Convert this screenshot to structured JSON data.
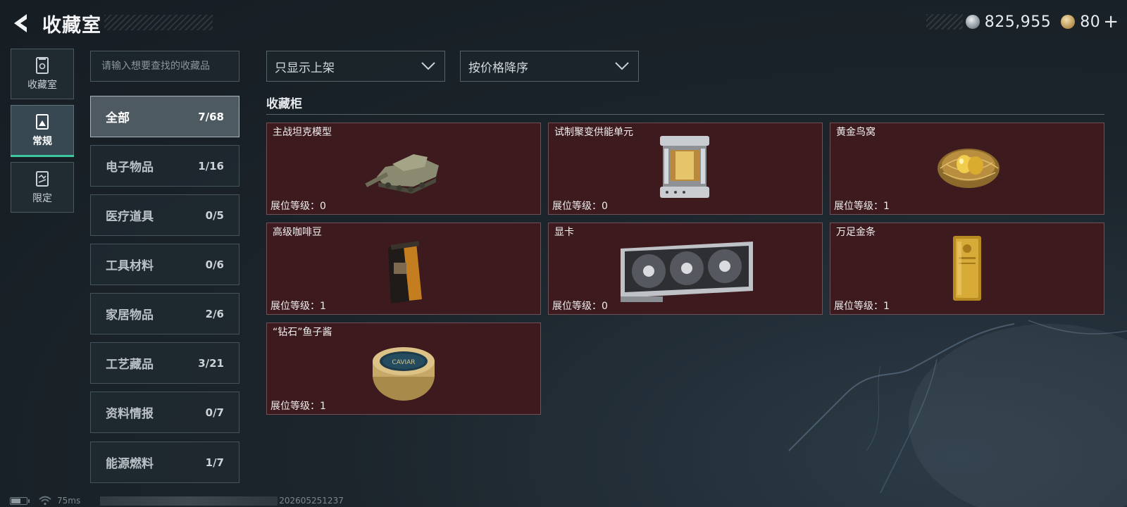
{
  "header": {
    "title": "收藏室",
    "currency": [
      {
        "icon": "silver-coin-icon",
        "value": "825,955"
      },
      {
        "icon": "gold-coin-icon",
        "value": "80"
      }
    ],
    "plus_label": "+"
  },
  "nav": [
    {
      "label": "收藏室",
      "icon": "collection-room-icon",
      "active": false
    },
    {
      "label": "常规",
      "icon": "regular-icon",
      "active": true
    },
    {
      "label": "限定",
      "icon": "limited-icon",
      "active": false
    }
  ],
  "search": {
    "placeholder": "请输入想要查找的收藏品",
    "value": ""
  },
  "categories": [
    {
      "name": "全部",
      "count": "7/68",
      "active": true
    },
    {
      "name": "电子物品",
      "count": "1/16"
    },
    {
      "name": "医疗道具",
      "count": "0/5"
    },
    {
      "name": "工具材料",
      "count": "0/6"
    },
    {
      "name": "家居物品",
      "count": "2/6"
    },
    {
      "name": "工艺藏品",
      "count": "3/21"
    },
    {
      "name": "资料情报",
      "count": "0/7"
    },
    {
      "name": "能源燃料",
      "count": "1/7"
    }
  ],
  "filters": {
    "shelf_filter": "只显示上架",
    "sort": "按价格降序"
  },
  "cabinet": {
    "title": "收藏柜",
    "items": [
      {
        "name": "主战坦克模型",
        "level_label": "展位等级：",
        "level": "0",
        "icon": "tank-model-icon"
      },
      {
        "name": "试制聚变供能单元",
        "level_label": "展位等级：",
        "level": "0",
        "icon": "fusion-unit-icon"
      },
      {
        "name": "黄金鸟窝",
        "level_label": "展位等级：",
        "level": "1",
        "icon": "golden-nest-icon"
      },
      {
        "name": "高级咖啡豆",
        "level_label": "展位等级：",
        "level": "1",
        "icon": "coffee-bag-icon"
      },
      {
        "name": "显卡",
        "level_label": "展位等级：",
        "level": "0",
        "icon": "graphics-card-icon"
      },
      {
        "name": "万足金条",
        "level_label": "展位等级：",
        "level": "1",
        "icon": "gold-bar-icon"
      },
      {
        "name": "“钻石”鱼子酱",
        "level_label": "展位等级：",
        "level": "1",
        "icon": "caviar-tin-icon",
        "tin_text": "CAVIAR"
      }
    ]
  },
  "footer": {
    "ping": "75ms",
    "build": "202605251237",
    "battery_fraction": 0.55
  },
  "colors": {
    "accent": "#3ec8a0",
    "card_bg": "#3d1a1e",
    "card_border": "#705055"
  }
}
